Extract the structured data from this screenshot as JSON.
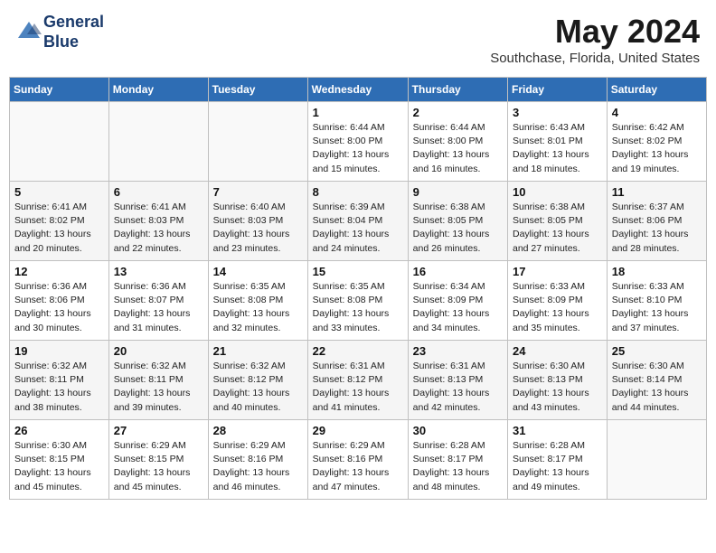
{
  "header": {
    "logo_line1": "General",
    "logo_line2": "Blue",
    "month_title": "May 2024",
    "location": "Southchase, Florida, United States"
  },
  "weekdays": [
    "Sunday",
    "Monday",
    "Tuesday",
    "Wednesday",
    "Thursday",
    "Friday",
    "Saturday"
  ],
  "weeks": [
    [
      {
        "day": "",
        "info": ""
      },
      {
        "day": "",
        "info": ""
      },
      {
        "day": "",
        "info": ""
      },
      {
        "day": "1",
        "info": "Sunrise: 6:44 AM\nSunset: 8:00 PM\nDaylight: 13 hours\nand 15 minutes."
      },
      {
        "day": "2",
        "info": "Sunrise: 6:44 AM\nSunset: 8:00 PM\nDaylight: 13 hours\nand 16 minutes."
      },
      {
        "day": "3",
        "info": "Sunrise: 6:43 AM\nSunset: 8:01 PM\nDaylight: 13 hours\nand 18 minutes."
      },
      {
        "day": "4",
        "info": "Sunrise: 6:42 AM\nSunset: 8:02 PM\nDaylight: 13 hours\nand 19 minutes."
      }
    ],
    [
      {
        "day": "5",
        "info": "Sunrise: 6:41 AM\nSunset: 8:02 PM\nDaylight: 13 hours\nand 20 minutes."
      },
      {
        "day": "6",
        "info": "Sunrise: 6:41 AM\nSunset: 8:03 PM\nDaylight: 13 hours\nand 22 minutes."
      },
      {
        "day": "7",
        "info": "Sunrise: 6:40 AM\nSunset: 8:03 PM\nDaylight: 13 hours\nand 23 minutes."
      },
      {
        "day": "8",
        "info": "Sunrise: 6:39 AM\nSunset: 8:04 PM\nDaylight: 13 hours\nand 24 minutes."
      },
      {
        "day": "9",
        "info": "Sunrise: 6:38 AM\nSunset: 8:05 PM\nDaylight: 13 hours\nand 26 minutes."
      },
      {
        "day": "10",
        "info": "Sunrise: 6:38 AM\nSunset: 8:05 PM\nDaylight: 13 hours\nand 27 minutes."
      },
      {
        "day": "11",
        "info": "Sunrise: 6:37 AM\nSunset: 8:06 PM\nDaylight: 13 hours\nand 28 minutes."
      }
    ],
    [
      {
        "day": "12",
        "info": "Sunrise: 6:36 AM\nSunset: 8:06 PM\nDaylight: 13 hours\nand 30 minutes."
      },
      {
        "day": "13",
        "info": "Sunrise: 6:36 AM\nSunset: 8:07 PM\nDaylight: 13 hours\nand 31 minutes."
      },
      {
        "day": "14",
        "info": "Sunrise: 6:35 AM\nSunset: 8:08 PM\nDaylight: 13 hours\nand 32 minutes."
      },
      {
        "day": "15",
        "info": "Sunrise: 6:35 AM\nSunset: 8:08 PM\nDaylight: 13 hours\nand 33 minutes."
      },
      {
        "day": "16",
        "info": "Sunrise: 6:34 AM\nSunset: 8:09 PM\nDaylight: 13 hours\nand 34 minutes."
      },
      {
        "day": "17",
        "info": "Sunrise: 6:33 AM\nSunset: 8:09 PM\nDaylight: 13 hours\nand 35 minutes."
      },
      {
        "day": "18",
        "info": "Sunrise: 6:33 AM\nSunset: 8:10 PM\nDaylight: 13 hours\nand 37 minutes."
      }
    ],
    [
      {
        "day": "19",
        "info": "Sunrise: 6:32 AM\nSunset: 8:11 PM\nDaylight: 13 hours\nand 38 minutes."
      },
      {
        "day": "20",
        "info": "Sunrise: 6:32 AM\nSunset: 8:11 PM\nDaylight: 13 hours\nand 39 minutes."
      },
      {
        "day": "21",
        "info": "Sunrise: 6:32 AM\nSunset: 8:12 PM\nDaylight: 13 hours\nand 40 minutes."
      },
      {
        "day": "22",
        "info": "Sunrise: 6:31 AM\nSunset: 8:12 PM\nDaylight: 13 hours\nand 41 minutes."
      },
      {
        "day": "23",
        "info": "Sunrise: 6:31 AM\nSunset: 8:13 PM\nDaylight: 13 hours\nand 42 minutes."
      },
      {
        "day": "24",
        "info": "Sunrise: 6:30 AM\nSunset: 8:13 PM\nDaylight: 13 hours\nand 43 minutes."
      },
      {
        "day": "25",
        "info": "Sunrise: 6:30 AM\nSunset: 8:14 PM\nDaylight: 13 hours\nand 44 minutes."
      }
    ],
    [
      {
        "day": "26",
        "info": "Sunrise: 6:30 AM\nSunset: 8:15 PM\nDaylight: 13 hours\nand 45 minutes."
      },
      {
        "day": "27",
        "info": "Sunrise: 6:29 AM\nSunset: 8:15 PM\nDaylight: 13 hours\nand 45 minutes."
      },
      {
        "day": "28",
        "info": "Sunrise: 6:29 AM\nSunset: 8:16 PM\nDaylight: 13 hours\nand 46 minutes."
      },
      {
        "day": "29",
        "info": "Sunrise: 6:29 AM\nSunset: 8:16 PM\nDaylight: 13 hours\nand 47 minutes."
      },
      {
        "day": "30",
        "info": "Sunrise: 6:28 AM\nSunset: 8:17 PM\nDaylight: 13 hours\nand 48 minutes."
      },
      {
        "day": "31",
        "info": "Sunrise: 6:28 AM\nSunset: 8:17 PM\nDaylight: 13 hours\nand 49 minutes."
      },
      {
        "day": "",
        "info": ""
      }
    ]
  ]
}
